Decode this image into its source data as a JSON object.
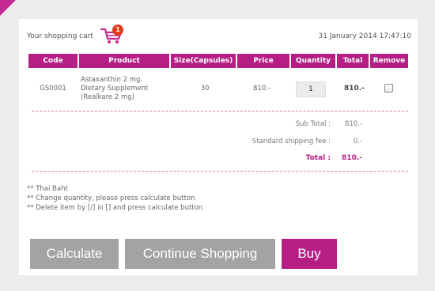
{
  "header": {
    "cart_label": "Your shopping cart",
    "cart_count": "1",
    "datetime": "31 January 2014 17:47:10"
  },
  "table": {
    "columns": [
      "Code",
      "Product",
      "Size(Capsules)",
      "Price",
      "Quantity",
      "Total",
      "Remove"
    ],
    "rows": [
      {
        "code": "GS0001",
        "product_line1": "Astaxanthin 2 mg.",
        "product_line2": "Dietary Supplement",
        "product_line3": "(Realkare 2 mg)",
        "size": "30",
        "price": "810.-",
        "quantity": "1",
        "total": "810.-",
        "remove_checked": false
      }
    ]
  },
  "summary": {
    "subtotal_label": "Sub Total :",
    "subtotal_value": "810.-",
    "shipping_label": "Standard shipping fee :",
    "shipping_value": "0.-",
    "total_label": "Total :",
    "total_value": "810.-"
  },
  "notes": [
    "** Thai Baht",
    "** Change quantity, please press calculate button",
    "** Delete item by [/] in [] and press calculate button"
  ],
  "buttons": {
    "calculate": "Calculate",
    "continue": "Continue Shopping",
    "buy": "Buy"
  },
  "colors": {
    "accent": "#b51f85",
    "button_gray": "#a3a3a3",
    "badge": "#e13d1e"
  }
}
